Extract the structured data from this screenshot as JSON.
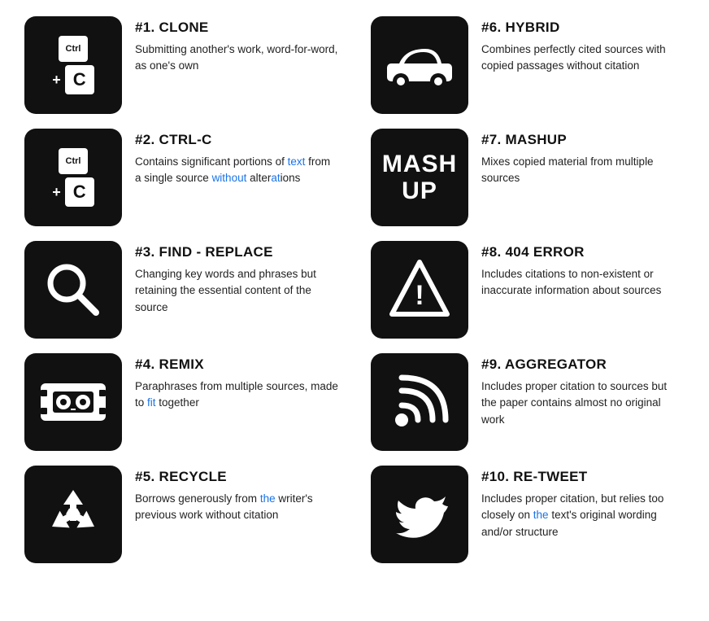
{
  "items": [
    {
      "id": "clone",
      "number": "#1. CLONE",
      "desc_parts": [
        {
          "text": "Submitting another's work, word-for-word, as one's own",
          "highlights": []
        }
      ],
      "desc": "Submitting another's work, word-for-word, as one's own",
      "icon_type": "ctrl-c-1"
    },
    {
      "id": "hybrid",
      "number": "#6. HYBRID",
      "desc": "Combines perfectly cited sources with copied passages without citation",
      "icon_type": "car"
    },
    {
      "id": "ctrl-c",
      "number": "#2. CTRL-C",
      "desc": "Contains significant portions of text from a single source without alterations",
      "icon_type": "ctrl-c-2"
    },
    {
      "id": "mashup",
      "number": "#7. MASHUP",
      "desc": "Mixes copied material from multiple sources",
      "icon_type": "mashup"
    },
    {
      "id": "find-replace",
      "number": "#3. FIND - REPLACE",
      "desc": "Changing key words and phrases but retaining the essential content of the source",
      "icon_type": "search"
    },
    {
      "id": "404-error",
      "number": "#8. 404 ERROR",
      "desc": "Includes citations to non-existent or inaccurate information about sources",
      "icon_type": "warning"
    },
    {
      "id": "remix",
      "number": "#4. REMIX",
      "desc": "Paraphrases from multiple sources, made to fit together",
      "icon_type": "cassette"
    },
    {
      "id": "aggregator",
      "number": "#9. AGGREGATOR",
      "desc": "Includes proper citation to sources but the paper contains almost no original work",
      "icon_type": "rss"
    },
    {
      "id": "recycle",
      "number": "#5. RECYCLE",
      "desc_before": "Borrows generously from ",
      "desc_link": "the",
      "desc_after": " writer's previous work without citation",
      "icon_type": "recycle"
    },
    {
      "id": "retweet",
      "number": "#10. RE-TWEET",
      "desc_before": "Includes proper citation, but relies too closely on ",
      "desc_link": "the",
      "desc_middle": " text's original wording and/or structure",
      "icon_type": "twitter"
    }
  ]
}
